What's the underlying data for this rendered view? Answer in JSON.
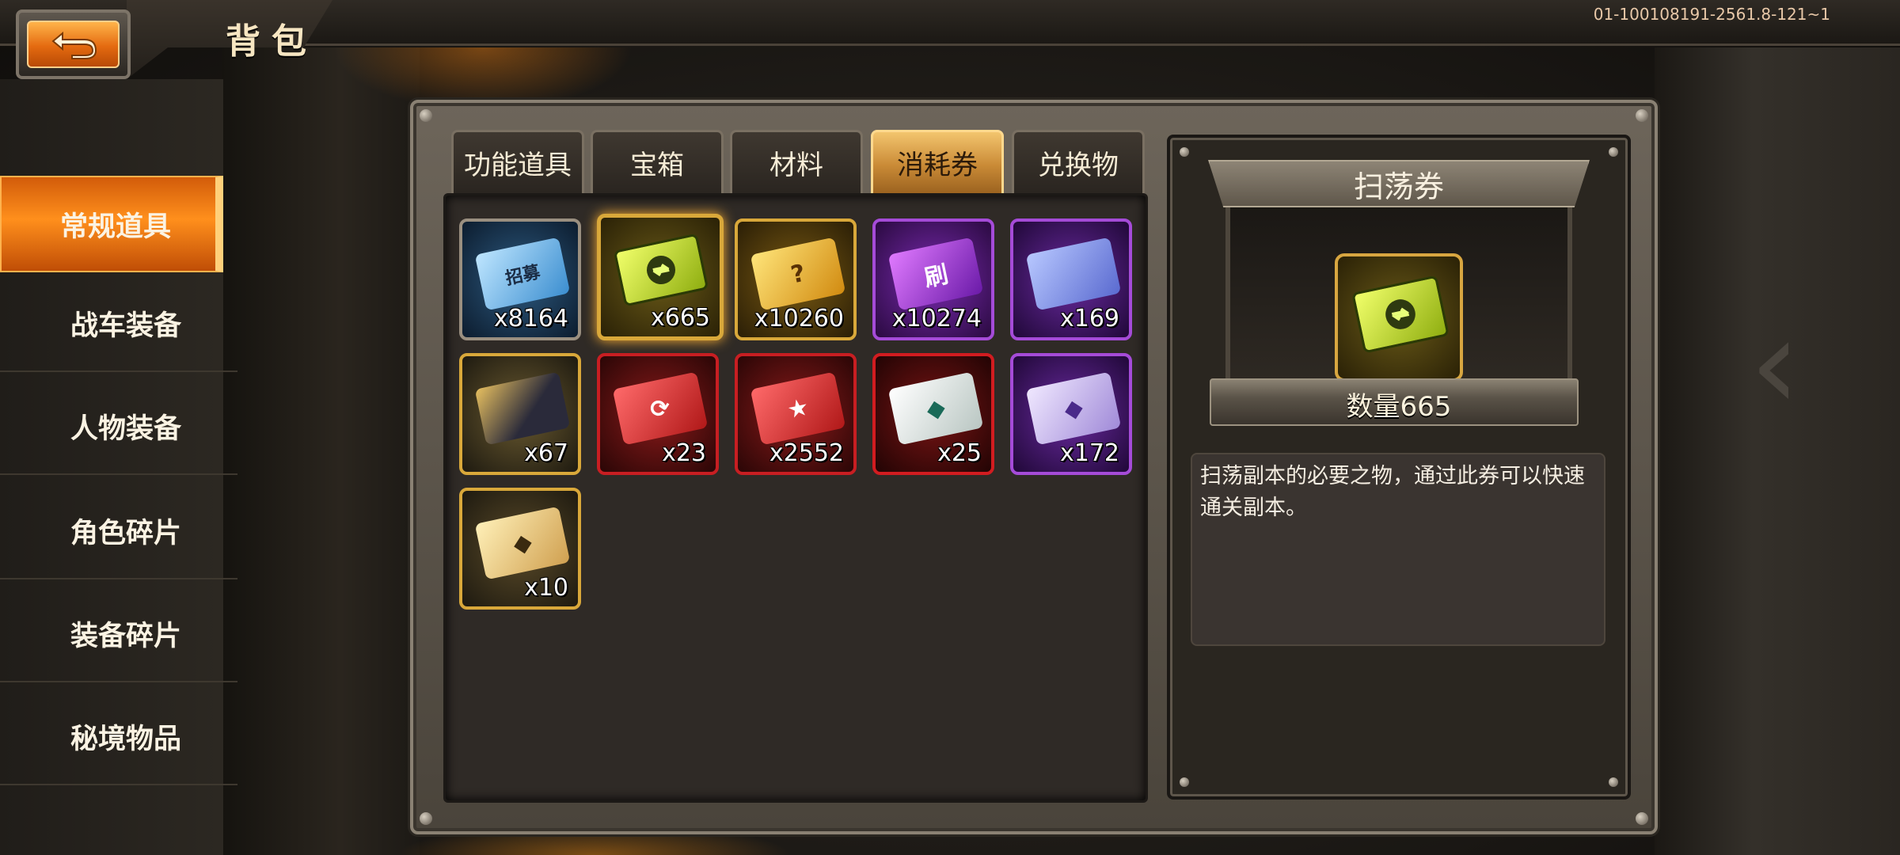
{
  "header": {
    "title": "背包",
    "build_id": "01-100108191-2561.8-121~1",
    "back_icon": "return-arrow-icon"
  },
  "sidebar": {
    "items": [
      {
        "label": "常规道具",
        "active": true
      },
      {
        "label": "战车装备",
        "active": false
      },
      {
        "label": "人物装备",
        "active": false
      },
      {
        "label": "角色碎片",
        "active": false
      },
      {
        "label": "装备碎片",
        "active": false
      },
      {
        "label": "秘境物品",
        "active": false
      }
    ]
  },
  "tabs": [
    {
      "label": "功能道具",
      "active": false
    },
    {
      "label": "宝箱",
      "active": false
    },
    {
      "label": "材料",
      "active": false
    },
    {
      "label": "消耗券",
      "active": true
    },
    {
      "label": "兑换物",
      "active": false
    }
  ],
  "items": [
    {
      "qty": "x8164",
      "icon": "recruit-ticket-blue-icon",
      "rarity": "blue",
      "glyph": "招募"
    },
    {
      "qty": "x665",
      "icon": "sweep-ticket-icon",
      "rarity": "gold",
      "selected": true
    },
    {
      "qty": "x10260",
      "icon": "recruit-ticket-gold-icon",
      "rarity": "gold"
    },
    {
      "qty": "x10274",
      "icon": "refresh-ticket-purple-icon",
      "rarity": "purple",
      "glyph": "刷"
    },
    {
      "qty": "x169",
      "icon": "purple-tag-icon",
      "rarity": "purple"
    },
    {
      "qty": "x67",
      "icon": "dark-gold-ticket-icon",
      "rarity": "gold"
    },
    {
      "qty": "x23",
      "icon": "red-refresh-ticket-icon",
      "rarity": "red"
    },
    {
      "qty": "x2552",
      "icon": "red-star-ticket-icon",
      "rarity": "red"
    },
    {
      "qty": "x25",
      "icon": "white-chip-ticket-icon",
      "rarity": "red"
    },
    {
      "qty": "x172",
      "icon": "lavender-chip-ticket-icon",
      "rarity": "purple"
    },
    {
      "qty": "x10",
      "icon": "gold-chip-ticket-icon",
      "rarity": "gold"
    }
  ],
  "detail": {
    "title": "扫荡券",
    "quantity_text": "数量665",
    "description": "扫荡副本的必要之物，通过此券可以快速通关副本。",
    "icon": "sweep-ticket-icon"
  },
  "colors": {
    "accent_orange": "#ff8f1c",
    "gold_border": "#ffcf5c",
    "panel_dark": "#2f2a26"
  }
}
